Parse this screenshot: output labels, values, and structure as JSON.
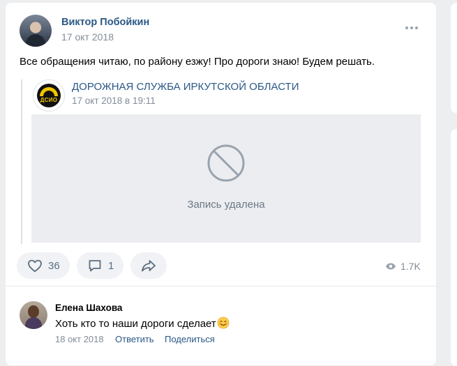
{
  "post": {
    "author_name": "Виктор Побойкин",
    "date": "17 окт 2018",
    "text": "Все обращения читаю, по району езжу! Про дороги знаю! Будем решать.",
    "more_icon": "more-horizontal-icon"
  },
  "repost": {
    "group_name": "ДОРОЖНАЯ СЛУЖБА ИРКУТСКОЙ ОБЛАСТИ",
    "group_logo_text": "ДСИО",
    "date": "17 окт 2018 в 19:11",
    "deleted_text": "Запись удалена",
    "deleted_icon": "block-icon"
  },
  "actions": {
    "likes": "36",
    "comments": "1",
    "views": "1.7K",
    "colors": {
      "icon": "#5c6d80",
      "pill_bg": "#f0f2f5"
    }
  },
  "comment": {
    "author_name": "Елена Шахова",
    "text": "Хоть кто то наши дороги сделает",
    "emoji": "smile-emoji-icon",
    "date": "18 окт 2018",
    "reply_label": "Ответить",
    "share_label": "Поделиться"
  },
  "colors": {
    "link": "#2a5885",
    "secondary_text": "#818c99",
    "page_bg": "#edeef0"
  }
}
